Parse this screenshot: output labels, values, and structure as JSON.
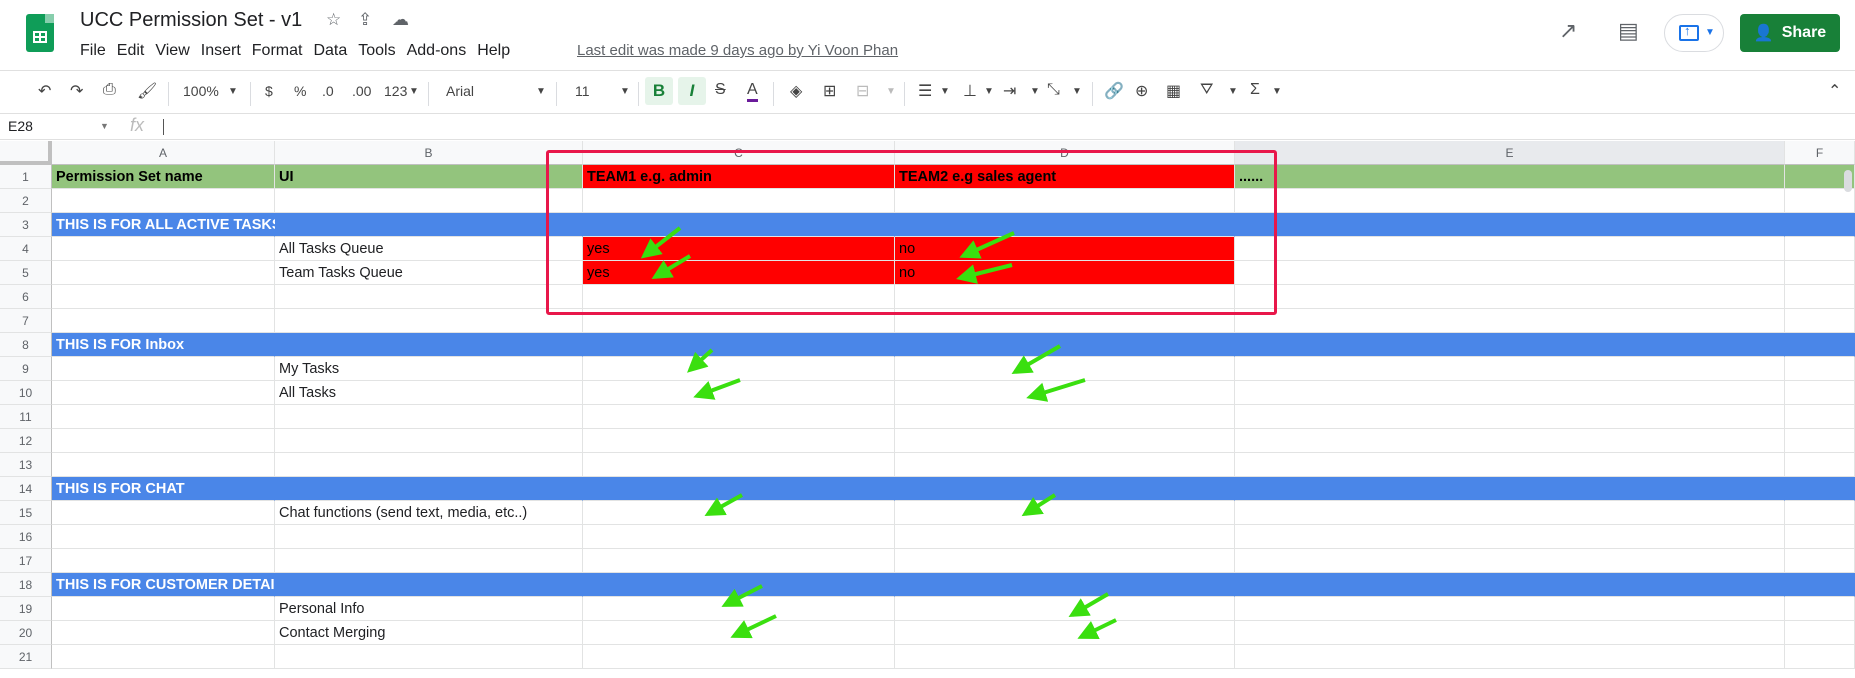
{
  "title": "UCC Permission Set - v1",
  "menu": [
    "File",
    "Edit",
    "View",
    "Insert",
    "Format",
    "Data",
    "Tools",
    "Add-ons",
    "Help"
  ],
  "last_edit": "Last edit was made 9 days ago by Yi Voon Phan",
  "share_label": "Share",
  "toolbar": {
    "zoom": "100%",
    "currency": "$",
    "percent": "%",
    "dec_less": ".0",
    "dec_more": ".00",
    "format_more": "123",
    "font": "Arial",
    "font_size": "11",
    "bold": "B",
    "italic": "I",
    "strike": "S",
    "text_color": "A",
    "sum": "Σ"
  },
  "namebox": "E28",
  "fx": "fx",
  "columns": [
    "A",
    "B",
    "C",
    "D",
    "E",
    "F"
  ],
  "rows": [
    {
      "n": "1",
      "a": "Permission Set name",
      "b": "UI",
      "c": "TEAM1 e.g. admin",
      "d": "TEAM2 e.g sales agent",
      "e": "......"
    },
    {
      "n": "2"
    },
    {
      "n": "3",
      "a": "THIS IS FOR ALL ACTIVE TASKS in the QUEUE"
    },
    {
      "n": "4",
      "b": "All Tasks Queue",
      "c": "yes",
      "d": "no"
    },
    {
      "n": "5",
      "b": "Team Tasks Queue",
      "c": "yes",
      "d": "no"
    },
    {
      "n": "6"
    },
    {
      "n": "7"
    },
    {
      "n": "8",
      "a": "THIS IS FOR Inbox"
    },
    {
      "n": "9",
      "b": "My Tasks"
    },
    {
      "n": "10",
      "b": "All Tasks"
    },
    {
      "n": "11"
    },
    {
      "n": "12"
    },
    {
      "n": "13"
    },
    {
      "n": "14",
      "a": "THIS IS FOR CHAT"
    },
    {
      "n": "15",
      "b": "Chat functions (send text, media, etc..)"
    },
    {
      "n": "16"
    },
    {
      "n": "17"
    },
    {
      "n": "18",
      "a": "THIS IS FOR CUSTOMER DETAILS"
    },
    {
      "n": "19",
      "b": "Personal Info"
    },
    {
      "n": "20",
      "b": "Contact Merging"
    },
    {
      "n": "21"
    }
  ],
  "colors": {
    "header_green": "#93c47d",
    "section_blue": "#4a86e8",
    "highlight_red": "#ff0000",
    "annotation_box": "#e8174a",
    "arrow_green": "#3adf0f",
    "share_green": "#188038"
  }
}
